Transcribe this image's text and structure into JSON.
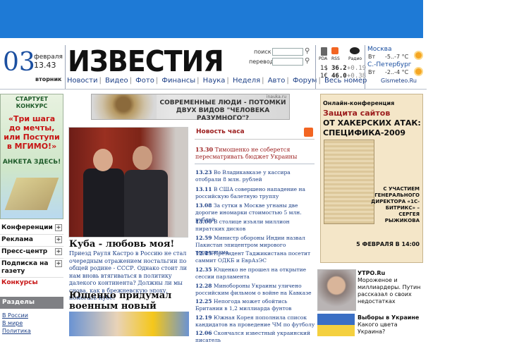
{
  "date": {
    "day": "03",
    "month": "февраля",
    "time": "13.43",
    "weekday": "вторник"
  },
  "logo": "ИЗВЕСТИЯ",
  "nav": [
    "Новости",
    "Видео",
    "Фото",
    "Финансы",
    "Наука",
    "Неделя",
    "Авто",
    "Форум",
    "Весь номер"
  ],
  "search": {
    "search_label": "поиск",
    "translate_label": "перевод"
  },
  "icons": {
    "pda": "PDA",
    "rss": "RSS",
    "radio": "Радио"
  },
  "currency": [
    {
      "symbol": "1$",
      "value": "36.2",
      "change": "+0.19"
    },
    {
      "symbol": "1€",
      "value": "46.0",
      "change": "+0.38"
    }
  ],
  "weather": {
    "cities": [
      {
        "name": "Москва",
        "day": "Вт",
        "temp": "-5..-7 °С"
      },
      {
        "name": "С.-Петербург",
        "day": "Вт",
        "temp": "-2..-4 °С"
      }
    ],
    "source": "Gismeteo.Ru"
  },
  "promo": {
    "start": "СТАРТУЕТ КОНКУРС",
    "main": "«Три шага до мечты, или Поступи в МГИМО!»",
    "anketa": "АНКЕТА ЗДЕСЬ!"
  },
  "left_menu": [
    "Конференции",
    "Реклама",
    "Пресс-центр",
    "Подписка на газету",
    "Конкурсы"
  ],
  "sections": {
    "title": "Разделы",
    "items": [
      "В России",
      "В мире",
      "Политика"
    ]
  },
  "banner": {
    "text": "СОВРЕМЕННЫЕ ЛЮДИ - ПОТОМКИ ДВУХ ВИДОВ \"ЧЕЛОВЕКА РАЗУМНОГО\"?",
    "site": "inauka.ru"
  },
  "main_story": {
    "title": "Куба - любовь моя!",
    "text": "Приезд Рауля Кастро в Россию не стал очередным отражением ностальгии по общей родине - СССР. Однако стоит ли нам вновь втягиваться в политику далекого континента? Должны ли мы снова, как в брежневскую эпоху, помогать Кубе?"
  },
  "second_story": {
    "title": "Ющенко придумал военным новый праздник"
  },
  "news_hour": {
    "title": "Новость часа",
    "hot": {
      "time": "13.30",
      "text": "Тимошенко не соберется пересматривать бюджет Украины"
    },
    "items": [
      {
        "time": "13.23",
        "text": "Во Владикавказе у кассира отобрали 8 млн. рублей"
      },
      {
        "time": "13.11",
        "text": "В США совершено нападение на российскую балетную труппу"
      },
      {
        "time": "13.08",
        "text": "За сутки в Москве угнаны две дорогие иномарки стоимостью 5 млн. рублей"
      },
      {
        "time": "13.00",
        "text": "В столице изъяли миллион пиратских дисков"
      },
      {
        "time": "12.59",
        "text": "Министр обороны Индии назвал Пакистан эпицентром мирового терроризма"
      },
      {
        "time": "12.45",
        "text": "Президент Таджикистана посетит саммит ОДКБ и ЕврАзЭС"
      },
      {
        "time": "12.35",
        "text": "Ющенко не прошел на открытие сессии парламента"
      },
      {
        "time": "12.28",
        "text": "Минобороны Украины уличено российским фильмом о войне на Кавказе"
      },
      {
        "time": "12.25",
        "text": "Непогода может обойтись Британии в 1,2 миллиарда фунтов"
      },
      {
        "time": "12.19",
        "text": "Южная Корея пополнила список кандидатов на проведение ЧМ по футболу"
      },
      {
        "time": "12.06",
        "text": "Скончался известный украинский писатель"
      }
    ]
  },
  "ad": {
    "line1": "Онлайн-конференция",
    "line2": "Защита сайтов",
    "line3": "ОТ ХАКЕРСКИХ АТАК:",
    "line4": "СПЕЦИФИКА-2009",
    "speaker": "С УЧАСТИЕМ ГЕНЕРАЛЬНОГО ДИРЕКТОРА «1С-БИТРИКС» – СЕРГЕЯ РЫЖИКОВА",
    "date": "5 ФЕВРАЛЯ В 14:00"
  },
  "utro": {
    "brand": "УТРО.Ru",
    "text": "Мороженое и миллиардеры. Путин рассказал о своих недостатках"
  },
  "ukraine": {
    "title": "Выборы в Украине",
    "text": "Какого цвета Украина?"
  }
}
